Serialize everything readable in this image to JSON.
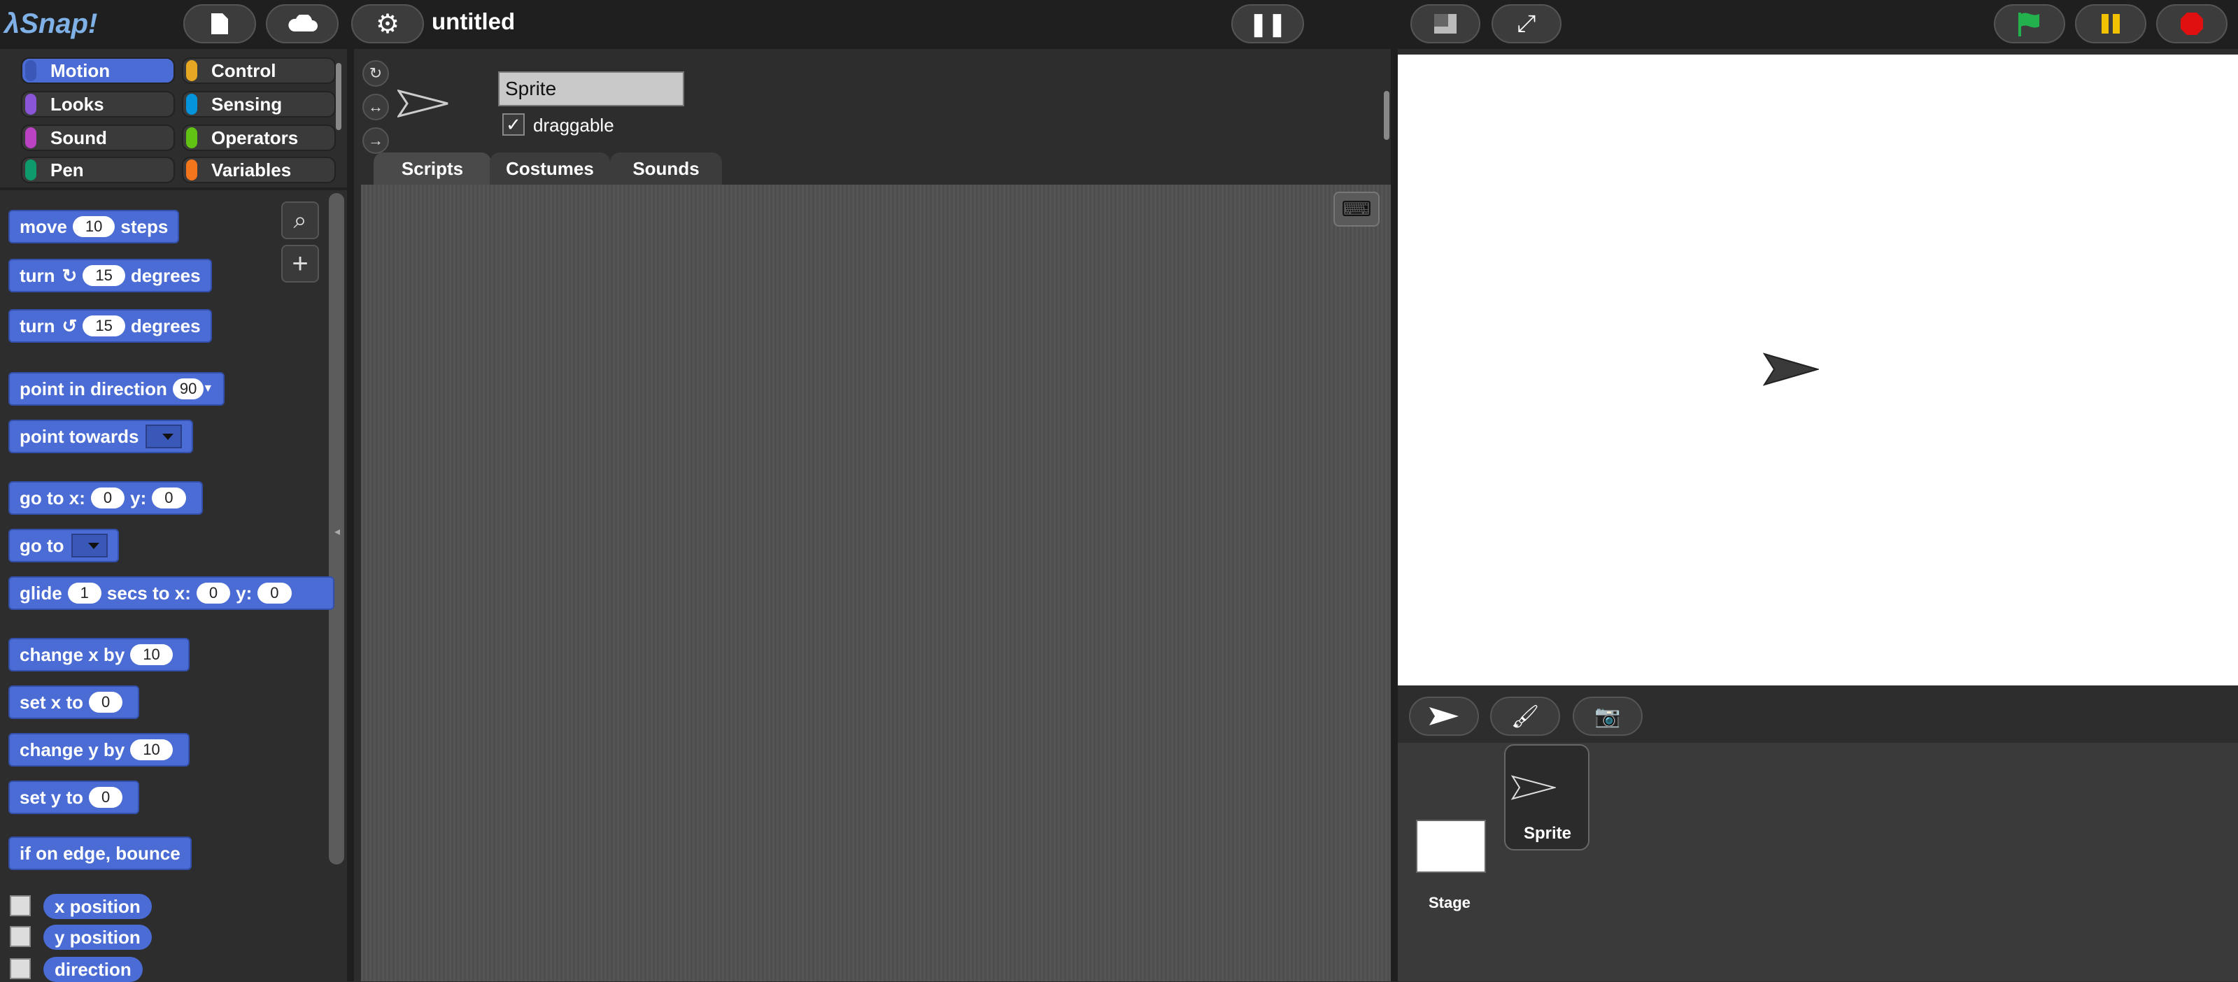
{
  "topbar": {
    "logo_prefix": "λ",
    "logo_text": "Snap!",
    "project_title": "untitled"
  },
  "categories": [
    {
      "label": "Motion",
      "color": "#4a6cd4"
    },
    {
      "label": "Looks",
      "color": "#8a55d7"
    },
    {
      "label": "Sound",
      "color": "#bb42c3"
    },
    {
      "label": "Pen",
      "color": "#0e9a6c"
    },
    {
      "label": "Control",
      "color": "#e6a822"
    },
    {
      "label": "Sensing",
      "color": "#0494dc"
    },
    {
      "label": "Operators",
      "color": "#62c213"
    },
    {
      "label": "Variables",
      "color": "#f3761d"
    }
  ],
  "palette": {
    "move": {
      "a": "move",
      "v": "10",
      "b": "steps"
    },
    "turn_cw": {
      "a": "turn",
      "icon": "↻",
      "v": "15",
      "b": "degrees"
    },
    "turn_ccw": {
      "a": "turn",
      "icon": "↺",
      "v": "15",
      "b": "degrees"
    },
    "point_dir": {
      "a": "point in direction",
      "v": "90"
    },
    "point_towards": {
      "a": "point towards"
    },
    "goto_xy": {
      "a": "go to x:",
      "x": "0",
      "b": "y:",
      "y": "0"
    },
    "goto": {
      "a": "go to"
    },
    "glide": {
      "a": "glide",
      "s": "1",
      "b": "secs to x:",
      "x": "0",
      "c": "y:",
      "y": "0"
    },
    "change_x": {
      "a": "change x by",
      "v": "10"
    },
    "set_x": {
      "a": "set x to",
      "v": "0"
    },
    "change_y": {
      "a": "change y by",
      "v": "10"
    },
    "set_y": {
      "a": "set y to",
      "v": "0"
    },
    "bounce": {
      "a": "if on edge, bounce"
    },
    "reporters": [
      "x position",
      "y position",
      "direction"
    ]
  },
  "sprite_editor": {
    "name": "Sprite",
    "draggable_label": "draggable",
    "draggable_checked": "✓",
    "tabs": [
      "Scripts",
      "Costumes",
      "Sounds"
    ]
  },
  "corral": {
    "stage_label": "Stage",
    "sprite_label": "Sprite"
  },
  "colors": {
    "motion": "#4a6cd4",
    "green_flag": "#22b14c",
    "pause": "#f2c200",
    "stop": "#e01010"
  }
}
